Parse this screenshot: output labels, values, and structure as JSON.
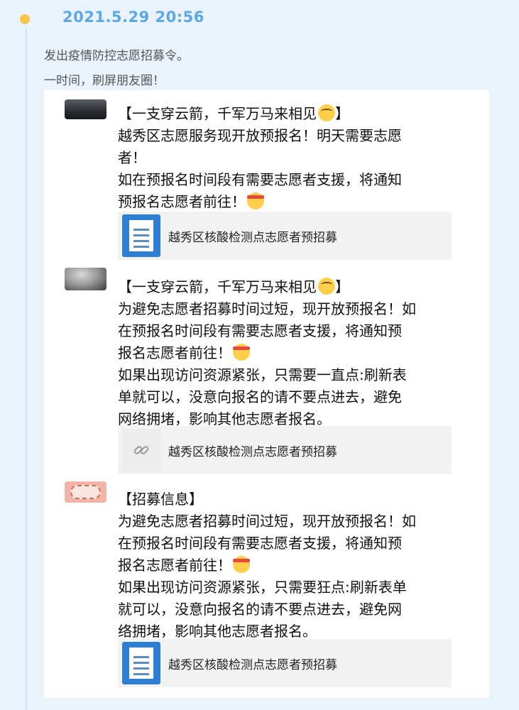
{
  "header": {
    "date": "2021.5.29 20:56",
    "intro_line1": "发出疫情防控志愿招募令。",
    "intro_line2": "一时间，刷屏朋友圈！"
  },
  "posts": [
    {
      "title": "【一支穿云箭，千军万马来相见",
      "title_end": "】",
      "line1": "越秀区志愿服务现开放预报名！明天需要志愿",
      "line2": "者！",
      "line3": "如在预报名时间段有需要志愿者支援，将通知",
      "line4": "预报名志愿者前往！",
      "link_title": "越秀区核酸检测点志愿者预招募",
      "link_icon": "document-icon"
    },
    {
      "title": "【一支穿云箭，千军万马来相见",
      "title_end": "】",
      "line1": "为避免志愿者招募时间过短，现开放预报名！如",
      "line2": "在预报名时间段有需要志愿者支援，将通知预",
      "line3": "报名志愿者前往！",
      "line4": "如果出现访问资源紧张，只需要一直点:刷新表",
      "line5": "单就可以，没意向报名的请不要点进去，避免",
      "line6": "网络拥堵，影响其他志愿者报名。",
      "link_title": "越秀区核酸检测点志愿者预招募",
      "link_icon": "link-chain-icon"
    },
    {
      "title": "【招募信息】",
      "line1": "为避免志愿者招募时间过短，现开放预报名！如",
      "line2": "在预报名时间段有需要志愿者支援，将通知预",
      "line3": "报名志愿者前往！",
      "line4": "如果出现访问资源紧张，只需要狂点:刷新表单",
      "line5": "就可以，没意向报名的请不要点进去，避免网",
      "line6": "络拥堵，影响其他志愿者报名。",
      "link_title": "越秀区核酸检测点志愿者预招募",
      "link_icon": "document-icon"
    }
  ],
  "colors": {
    "background": "#eaf3fb",
    "date": "#5aa8e6",
    "timeline_dot": "#f7c548",
    "doc_icon": "#2e7fd1"
  }
}
